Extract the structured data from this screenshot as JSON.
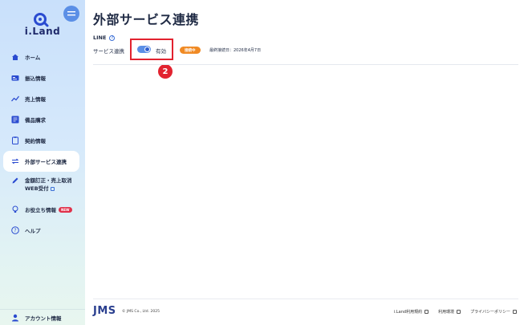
{
  "brand": {
    "logo_text": "i.Land"
  },
  "sidebar": {
    "items": [
      {
        "label": "ホーム",
        "icon": "home-icon"
      },
      {
        "label": "振込情報",
        "icon": "bank-transfer-icon"
      },
      {
        "label": "売上情報",
        "icon": "chart-line-icon"
      },
      {
        "label": "備品購求",
        "icon": "supplies-icon"
      },
      {
        "label": "契約情報",
        "icon": "clipboard-icon"
      },
      {
        "label": "外部サービス連携",
        "icon": "swap-icon",
        "active": true
      },
      {
        "label": "金額訂正・売上取消",
        "label2": "WEB受付",
        "icon": "pencil-icon"
      },
      {
        "label": "お役立ち情報",
        "icon": "bulb-icon",
        "badge": "NEW"
      },
      {
        "label": "ヘルプ",
        "icon": "help-circle-icon"
      }
    ],
    "account": {
      "label": "アカウント情報",
      "icon": "user-icon"
    }
  },
  "main": {
    "title": "外部サービス連携",
    "section": {
      "label": "LINE",
      "help": "?"
    },
    "row": {
      "label": "サービス連携",
      "toggle_text": "有効",
      "status": "接続中",
      "last_connected": "最終接続日：2026年4月7日",
      "step": "2"
    }
  },
  "footer": {
    "logo": "JMS",
    "copyright": "© JMS Co., Ltd. 2025",
    "links": [
      "i.Land利用規約",
      "利用環境",
      "プライバシーポリシー"
    ]
  },
  "colors": {
    "accent": "#5b8fe6",
    "highlight": "#e2222f",
    "status": "#f08a24",
    "navy": "#1f2a44"
  }
}
